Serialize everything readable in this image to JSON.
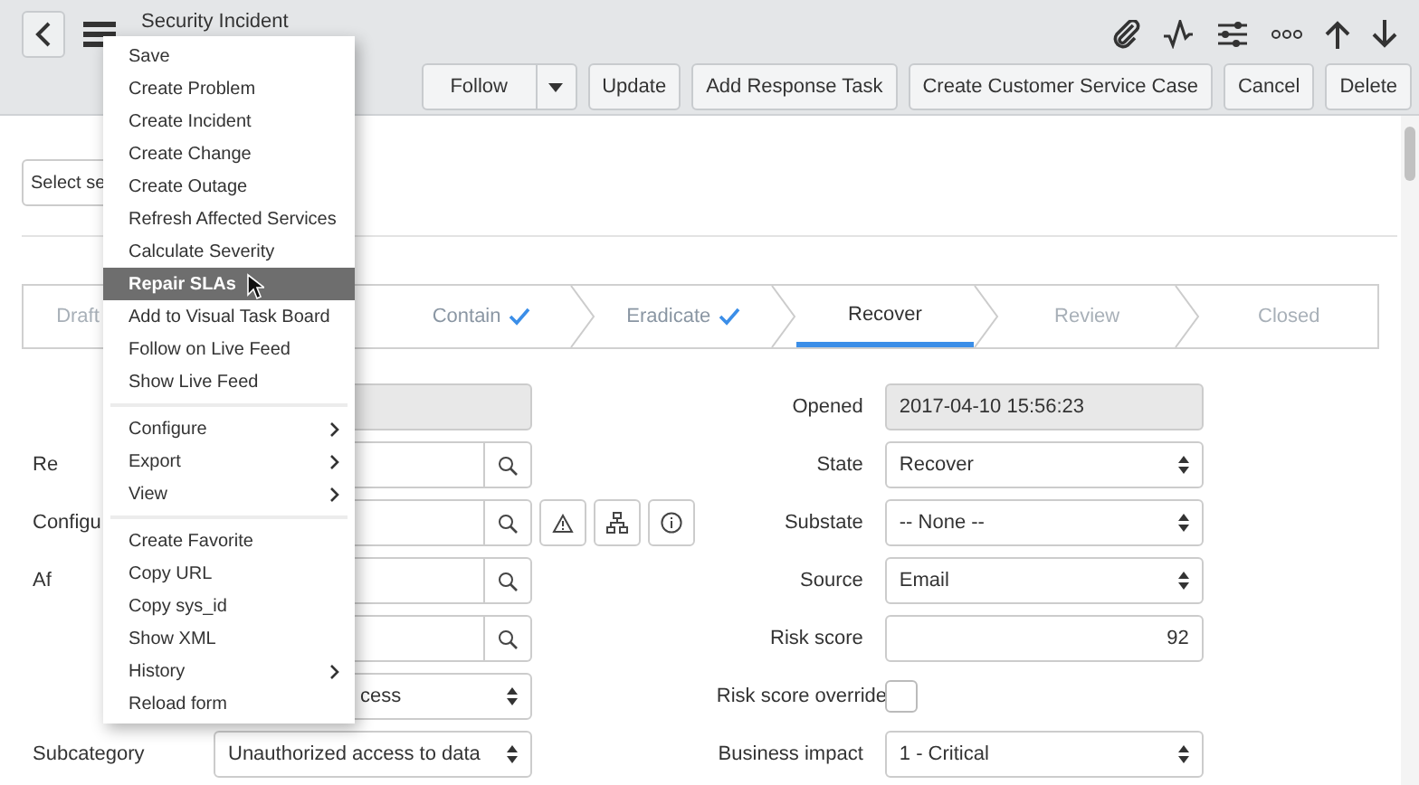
{
  "header": {
    "title": "Security Incident",
    "buttons": [
      {
        "label": "Follow",
        "kind": "split"
      },
      {
        "label": "Update",
        "kind": "plain"
      },
      {
        "label": "Add Response Task",
        "kind": "plain"
      },
      {
        "label": "Create Customer Service Case",
        "kind": "plain"
      },
      {
        "label": "Cancel",
        "kind": "plain"
      },
      {
        "label": "Delete",
        "kind": "plain"
      }
    ]
  },
  "view_select": {
    "value": "Select se"
  },
  "stages": [
    {
      "label": "Draft",
      "done": false,
      "selected": false
    },
    {
      "label": "Contain",
      "done": true,
      "selected": false
    },
    {
      "label": "Eradicate",
      "done": true,
      "selected": false
    },
    {
      "label": "Recover",
      "done": false,
      "selected": true
    },
    {
      "label": "Review",
      "done": false,
      "selected": false
    },
    {
      "label": "Closed",
      "done": false,
      "selected": false
    }
  ],
  "left_fields": [
    {
      "kind": "readonly"
    },
    {
      "label": "Re",
      "kind": "lookup"
    },
    {
      "label": "Configu",
      "kind": "ci_lookup"
    },
    {
      "label": "Af",
      "kind": "lookup"
    },
    {
      "kind": "lookup"
    },
    {
      "kind": "select",
      "value": "cess"
    },
    {
      "label": "Subcategory",
      "kind": "select",
      "value": "Unauthorized access to data"
    }
  ],
  "right_fields": [
    {
      "label": "Opened",
      "kind": "readonly",
      "value": "2017-04-10 15:56:23"
    },
    {
      "label": "State",
      "kind": "select",
      "value": "Recover"
    },
    {
      "label": "Substate",
      "kind": "select",
      "value": "-- None --"
    },
    {
      "label": "Source",
      "kind": "select",
      "value": "Email"
    },
    {
      "label": "Risk score",
      "kind": "number",
      "value": "92"
    },
    {
      "label": "Risk score override",
      "kind": "checkbox",
      "checked": false
    },
    {
      "label": "Business impact",
      "kind": "select",
      "value": "1 - Critical"
    }
  ],
  "context_menu": [
    {
      "kind": "item",
      "label": "Save",
      "selected": false,
      "submenu": false
    },
    {
      "kind": "item",
      "label": "Create Problem",
      "selected": false,
      "submenu": false
    },
    {
      "kind": "item",
      "label": "Create Incident",
      "selected": false,
      "submenu": false
    },
    {
      "kind": "item",
      "label": "Create Change",
      "selected": false,
      "submenu": false
    },
    {
      "kind": "item",
      "label": "Create Outage",
      "selected": false,
      "submenu": false
    },
    {
      "kind": "item",
      "label": "Refresh Affected Services",
      "selected": false,
      "submenu": false
    },
    {
      "kind": "item",
      "label": "Calculate Severity",
      "selected": false,
      "submenu": false
    },
    {
      "kind": "item",
      "label": "Repair SLAs",
      "selected": true,
      "submenu": false
    },
    {
      "kind": "item",
      "label": "Add to Visual Task Board",
      "selected": false,
      "submenu": false
    },
    {
      "kind": "item",
      "label": "Follow on Live Feed",
      "selected": false,
      "submenu": false
    },
    {
      "kind": "item",
      "label": "Show Live Feed",
      "selected": false,
      "submenu": false
    },
    {
      "kind": "separator"
    },
    {
      "kind": "item",
      "label": "Configure",
      "selected": false,
      "submenu": true
    },
    {
      "kind": "item",
      "label": "Export",
      "selected": false,
      "submenu": true
    },
    {
      "kind": "item",
      "label": "View",
      "selected": false,
      "submenu": true
    },
    {
      "kind": "separator"
    },
    {
      "kind": "item",
      "label": "Create Favorite",
      "selected": false,
      "submenu": false
    },
    {
      "kind": "item",
      "label": "Copy URL",
      "selected": false,
      "submenu": false
    },
    {
      "kind": "item",
      "label": "Copy sys_id",
      "selected": false,
      "submenu": false
    },
    {
      "kind": "item",
      "label": "Show XML",
      "selected": false,
      "submenu": false
    },
    {
      "kind": "item",
      "label": "History",
      "selected": false,
      "submenu": true
    },
    {
      "kind": "item",
      "label": "Reload form",
      "selected": false,
      "submenu": false
    }
  ]
}
